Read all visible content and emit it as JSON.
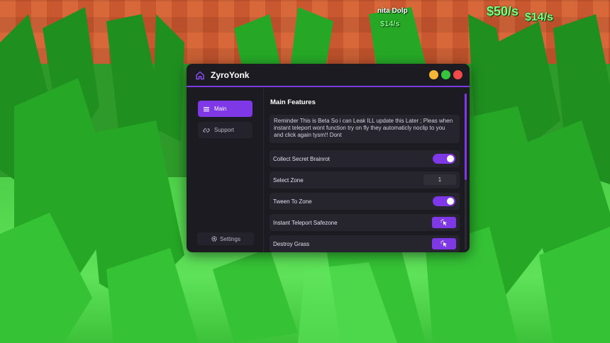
{
  "background": {
    "hud": {
      "name": "nita Dolp",
      "rate_small": "$14/s",
      "rate_big": "$50/s",
      "rate_big2": "$14/s"
    }
  },
  "window": {
    "title": "ZyroYonk",
    "controls": [
      "minimize",
      "maximize",
      "close"
    ]
  },
  "sidebar": {
    "items": [
      {
        "label": "Main",
        "icon": "menu-icon",
        "active": true
      },
      {
        "label": "Support",
        "icon": "link-icon",
        "active": false
      }
    ],
    "settings_label": "Settings"
  },
  "main": {
    "section_title": "Main Features",
    "notice": "Reminder This is Beta So i can Leak ILL update this Later ; Pleas when instant teleport wont function try on fly they automaticly noclip to you and click again tysm!! Dont",
    "rows": [
      {
        "label": "Collect Secret Brainrot",
        "control": "toggle",
        "state": "on"
      },
      {
        "label": "Select Zone",
        "control": "number",
        "value": "1"
      },
      {
        "label": "Tween To Zone",
        "control": "toggle",
        "state": "on"
      },
      {
        "label": "Instant Teleport Safezone",
        "control": "button",
        "icon": "cursor-click-icon"
      },
      {
        "label": "Destroy Grass",
        "control": "button",
        "icon": "cursor-click-icon"
      }
    ]
  },
  "colors": {
    "accent": "#7f38e6",
    "window_bg": "#1c1b22",
    "row_bg": "#26252d"
  }
}
